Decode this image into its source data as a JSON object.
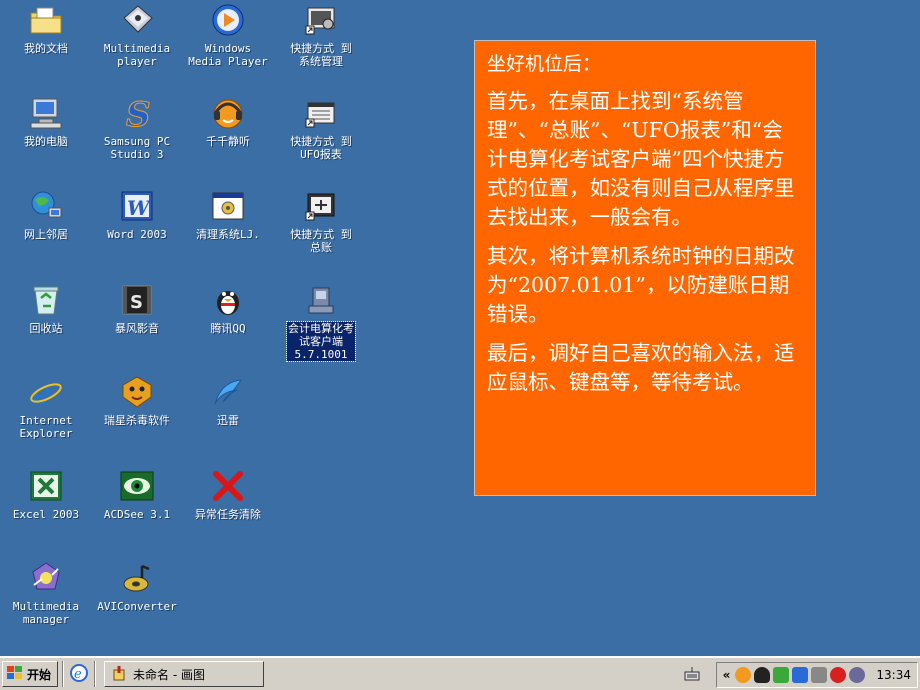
{
  "desktop": {
    "background_color": "#3a6ea5",
    "icons": [
      {
        "label": "我的文档",
        "icon": "folder-documents-icon"
      },
      {
        "label": "Multimedia\nplayer",
        "icon": "media-player-icon"
      },
      {
        "label": "Windows\nMedia Player",
        "icon": "windows-media-player-icon"
      },
      {
        "label": "快捷方式 到\n系统管理",
        "icon": "system-management-shortcut-icon"
      },
      {
        "label": "我的电脑",
        "icon": "my-computer-icon"
      },
      {
        "label": "Samsung PC\nStudio 3",
        "icon": "samsung-pc-studio-icon"
      },
      {
        "label": "千千静听",
        "icon": "ttplayer-icon"
      },
      {
        "label": "快捷方式 到\nUFO报表",
        "icon": "ufo-report-shortcut-icon"
      },
      {
        "label": "网上邻居",
        "icon": "network-places-icon"
      },
      {
        "label": "Word 2003",
        "icon": "word-icon"
      },
      {
        "label": "清理系统LJ.",
        "icon": "cleanup-script-icon"
      },
      {
        "label": "快捷方式 到\n总账",
        "icon": "ledger-shortcut-icon"
      },
      {
        "label": "回收站",
        "icon": "recycle-bin-icon"
      },
      {
        "label": "暴风影音",
        "icon": "storm-player-icon"
      },
      {
        "label": "腾讯QQ",
        "icon": "qq-penguin-icon"
      },
      {
        "label": "会计电算化考\n试客户端\n5.7.1001",
        "icon": "exam-client-icon",
        "selected": true
      },
      {
        "label": "Internet\nExplorer",
        "icon": "internet-explorer-icon"
      },
      {
        "label": "瑞星杀毒软件",
        "icon": "rising-antivirus-icon"
      },
      {
        "label": "迅雷",
        "icon": "thunder-icon"
      },
      {
        "label": "Excel 2003",
        "icon": "excel-icon"
      },
      {
        "label": "ACDSee 3.1",
        "icon": "acdsee-eye-icon"
      },
      {
        "label": "异常任务清除",
        "icon": "task-cleaner-x-icon"
      },
      {
        "label": "Multimedia\nmanager",
        "icon": "multimedia-manager-icon"
      },
      {
        "label": "AVIConverter",
        "icon": "avi-converter-icon"
      }
    ]
  },
  "note": {
    "background_color": "#ff6600",
    "heading": "坐好机位后：",
    "paragraphs": [
      "首先，在桌面上找到“系统管理”、“总账”、“UFO报表”和“会计电算化考试客户端”四个快捷方式的位置，如没有则自己从程序里去找出来，一般会有。",
      "其次，将计算机系统时钟的日期改为“2007.01.01”，以防建账日期错误。",
      "最后，调好自己喜欢的输入法，适应鼠标、键盘等，等待考试。"
    ]
  },
  "taskbar": {
    "start_label": "开始",
    "task_label": "未命名 - 画图",
    "tray_chevron": "«",
    "clock": "13:34"
  }
}
